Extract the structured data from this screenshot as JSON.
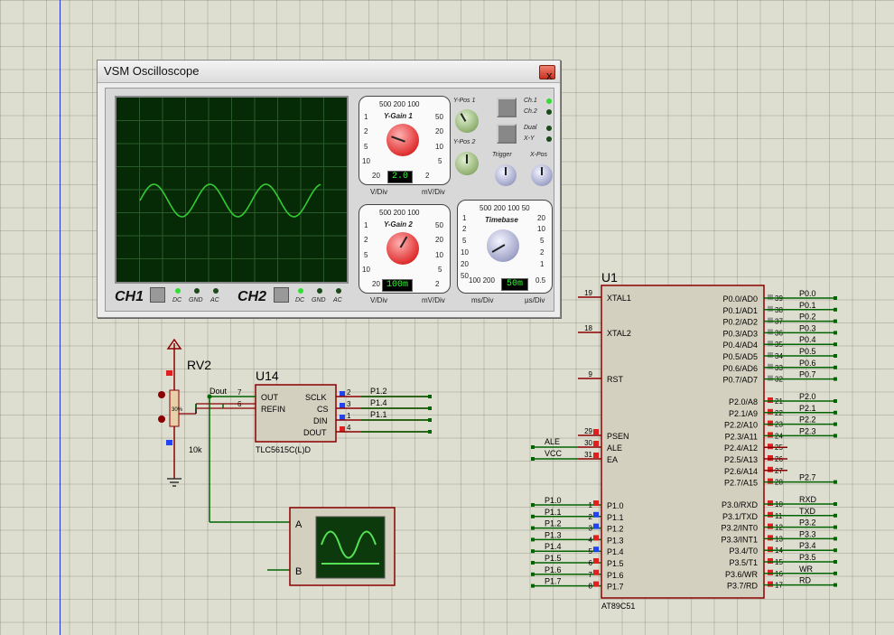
{
  "oscilloscope": {
    "title": "VSM Oscilloscope",
    "close_symbol": "x",
    "ch1_label": "CH1",
    "ch2_label": "CH2",
    "coupling": [
      "DC",
      "GND",
      "AC"
    ],
    "ygain1": {
      "title": "Y-Gain 1",
      "scale_top": "500 200 100",
      "left": [
        "1",
        "2",
        "5",
        "10"
      ],
      "right": [
        "50",
        "20",
        "10",
        "5"
      ],
      "bottom_left": "20",
      "bottom_right": "2",
      "value": "2.0",
      "unit_left": "V/Div",
      "unit_right": "mV/Div"
    },
    "ygain2": {
      "title": "Y-Gain 2",
      "scale_top": "500 200 100",
      "left": [
        "1",
        "2",
        "5",
        "10"
      ],
      "right": [
        "50",
        "20",
        "10",
        "5"
      ],
      "bottom_left": "20",
      "bottom_right": "2",
      "value": "100m",
      "unit_left": "V/Div",
      "unit_right": "mV/Div"
    },
    "timebase": {
      "title": "Timebase",
      "scale_top": "500 200 100 50",
      "left": [
        "1",
        "2",
        "5",
        "10",
        "20",
        "50"
      ],
      "right": [
        "20",
        "10",
        "5",
        "2",
        "1",
        "0.5"
      ],
      "bottom_left": "100 200",
      "value": "50m",
      "unit_left": "ms/Div",
      "unit_right": "µs/Div"
    },
    "ypos1": "Y-Pos 1",
    "ypos2": "Y-Pos 2",
    "trigger": "Trigger",
    "xpos": "X-Pos",
    "mode_ch1": "Ch.1",
    "mode_ch2": "Ch.2",
    "mode_dual": "Dual",
    "mode_xy": "X-Y",
    "trace_color": "#33cc33"
  },
  "schematic": {
    "rv2": {
      "ref": "RV2",
      "value": "10k",
      "body": "30%"
    },
    "u14": {
      "ref": "U14",
      "part": "TLC5615C(L)D",
      "pins_left": [
        {
          "num": "7",
          "name": "OUT"
        },
        {
          "num": "6",
          "name": "REFIN"
        }
      ],
      "pins_right": [
        {
          "num": "2",
          "name": "SCLK"
        },
        {
          "num": "3",
          "name": "CS"
        },
        {
          "num": "1",
          "name": "DIN"
        },
        {
          "num": "4",
          "name": "DOUT"
        }
      ],
      "net_labels": [
        "P1.2",
        "P1.4",
        "P1.1"
      ],
      "dout_net": "Dout"
    },
    "scope": {
      "ch_a": "A",
      "ch_b": "B"
    },
    "u1": {
      "ref": "U1",
      "part": "AT89C51",
      "left_pins": [
        {
          "num": "19",
          "name": "XTAL1"
        },
        {
          "num": "18",
          "name": "XTAL2"
        },
        {
          "num": "9",
          "name": "RST"
        },
        {
          "num": "29",
          "name": "PSEN"
        },
        {
          "num": "30",
          "name": "ALE"
        },
        {
          "num": "31",
          "name": "EA"
        }
      ],
      "left_nets": [
        "ALE",
        "VCC"
      ],
      "p1_pins": [
        {
          "num": "1",
          "name": "P1.0",
          "net": "P1.0"
        },
        {
          "num": "2",
          "name": "P1.1",
          "net": "P1.1"
        },
        {
          "num": "3",
          "name": "P1.2",
          "net": "P1.2"
        },
        {
          "num": "4",
          "name": "P1.3",
          "net": "P1.3"
        },
        {
          "num": "5",
          "name": "P1.4",
          "net": "P1.4"
        },
        {
          "num": "6",
          "name": "P1.5",
          "net": "P1.5"
        },
        {
          "num": "7",
          "name": "P1.6",
          "net": "P1.6"
        },
        {
          "num": "8",
          "name": "P1.7",
          "net": "P1.7"
        }
      ],
      "p0_pins": [
        {
          "num": "39",
          "name": "P0.0/AD0",
          "net": "P0.0"
        },
        {
          "num": "38",
          "name": "P0.1/AD1",
          "net": "P0.1"
        },
        {
          "num": "37",
          "name": "P0.2/AD2",
          "net": "P0.2"
        },
        {
          "num": "36",
          "name": "P0.3/AD3",
          "net": "P0.3"
        },
        {
          "num": "35",
          "name": "P0.4/AD4",
          "net": "P0.4"
        },
        {
          "num": "34",
          "name": "P0.5/AD5",
          "net": "P0.5"
        },
        {
          "num": "33",
          "name": "P0.6/AD6",
          "net": "P0.6"
        },
        {
          "num": "32",
          "name": "P0.7/AD7",
          "net": "P0.7"
        }
      ],
      "p2_pins": [
        {
          "num": "21",
          "name": "P2.0/A8",
          "net": "P2.0"
        },
        {
          "num": "22",
          "name": "P2.1/A9",
          "net": "P2.1"
        },
        {
          "num": "23",
          "name": "P2.2/A10",
          "net": "P2.2"
        },
        {
          "num": "24",
          "name": "P2.3/A11",
          "net": "P2.3"
        },
        {
          "num": "25",
          "name": "P2.4/A12",
          "net": ""
        },
        {
          "num": "26",
          "name": "P2.5/A13",
          "net": ""
        },
        {
          "num": "27",
          "name": "P2.6/A14",
          "net": ""
        },
        {
          "num": "28",
          "name": "P2.7/A15",
          "net": "P2.7"
        }
      ],
      "p3_pins": [
        {
          "num": "10",
          "name": "P3.0/RXD",
          "net": "RXD"
        },
        {
          "num": "11",
          "name": "P3.1/TXD",
          "net": "TXD"
        },
        {
          "num": "12",
          "name": "P3.2/INT0",
          "net": "P3.2"
        },
        {
          "num": "13",
          "name": "P3.3/INT1",
          "net": "P3.3"
        },
        {
          "num": "14",
          "name": "P3.4/T0",
          "net": "P3.4"
        },
        {
          "num": "15",
          "name": "P3.5/T1",
          "net": "P3.5"
        },
        {
          "num": "16",
          "name": "P3.6/WR",
          "net": "WR"
        },
        {
          "num": "17",
          "name": "P3.7/RD",
          "net": "RD"
        }
      ]
    }
  }
}
